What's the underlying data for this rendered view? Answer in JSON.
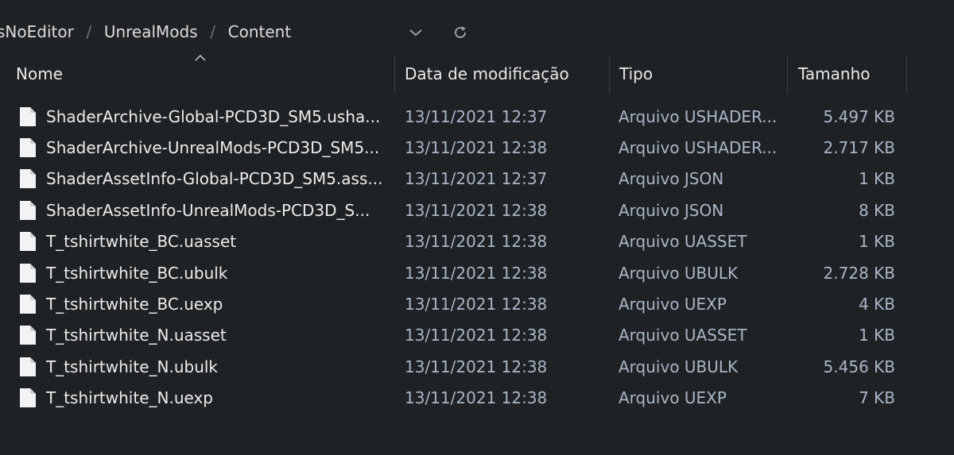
{
  "breadcrumb": {
    "items": [
      "sNoEditor",
      "UnrealMods",
      "Content"
    ]
  },
  "columns": {
    "name": "Nome",
    "date": "Data de modificação",
    "type": "Tipo",
    "size": "Tamanho"
  },
  "files": [
    {
      "name": "ShaderArchive-Global-PCD3D_SM5.usha...",
      "date": "13/11/2021 12:37",
      "type": "Arquivo USHADER...",
      "size": "5.497 KB"
    },
    {
      "name": "ShaderArchive-UnrealMods-PCD3D_SM5...",
      "date": "13/11/2021 12:38",
      "type": "Arquivo USHADER...",
      "size": "2.717 KB"
    },
    {
      "name": "ShaderAssetInfo-Global-PCD3D_SM5.ass...",
      "date": "13/11/2021 12:37",
      "type": "Arquivo JSON",
      "size": "1 KB"
    },
    {
      "name": "ShaderAssetInfo-UnrealMods-PCD3D_S...",
      "date": "13/11/2021 12:38",
      "type": "Arquivo JSON",
      "size": "8 KB"
    },
    {
      "name": "T_tshirtwhite_BC.uasset",
      "date": "13/11/2021 12:38",
      "type": "Arquivo UASSET",
      "size": "1 KB"
    },
    {
      "name": "T_tshirtwhite_BC.ubulk",
      "date": "13/11/2021 12:38",
      "type": "Arquivo UBULK",
      "size": "2.728 KB"
    },
    {
      "name": "T_tshirtwhite_BC.uexp",
      "date": "13/11/2021 12:38",
      "type": "Arquivo UEXP",
      "size": "4 KB"
    },
    {
      "name": "T_tshirtwhite_N.uasset",
      "date": "13/11/2021 12:38",
      "type": "Arquivo UASSET",
      "size": "1 KB"
    },
    {
      "name": "T_tshirtwhite_N.ubulk",
      "date": "13/11/2021 12:38",
      "type": "Arquivo UBULK",
      "size": "5.456 KB"
    },
    {
      "name": "T_tshirtwhite_N.uexp",
      "date": "13/11/2021 12:38",
      "type": "Arquivo UEXP",
      "size": "7 KB"
    }
  ],
  "icons": {
    "file": "file-icon",
    "sort": "sort-ascending-icon",
    "dropdown": "chevron-down-icon",
    "refresh": "refresh-icon"
  },
  "colors": {
    "background": "#1f2225",
    "text": "#ececec",
    "secondary_text": "#a9b6c7"
  }
}
